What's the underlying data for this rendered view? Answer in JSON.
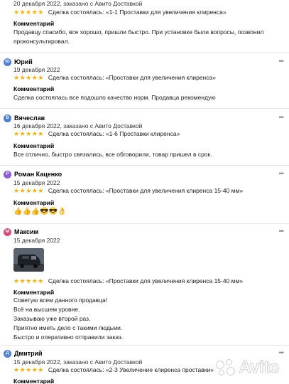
{
  "colors": {
    "star": "#ffb000",
    "avatar_yu": "#4a7fd4",
    "avatar_v": "#4a7fd4",
    "avatar_r": "#8a5bd6",
    "avatar_m": "#d94a7a",
    "avatar_d": "#4a7fd4"
  },
  "reviews": [
    {
      "meta": "20 декабря 2022, заказано с Авито Доставкой",
      "stars": "★★★★★",
      "deal": "Сделка состоялась: «1-1 Проставки для увеличения клиренса»",
      "comment_label": "Комментарий",
      "comment_lines": [
        "Продавцу спасибо, все хорошо, пришли быстро. При установке были вопросы, позвонил",
        "проконсультировал."
      ]
    },
    {
      "avatar": "Ю",
      "name": "Юрий",
      "more": "•••",
      "meta": "19 декабря 2022",
      "stars": "★★★★★",
      "deal": "Сделка состоялась: «Проставки для увеличения клиренса»",
      "comment_label": "Комментарий",
      "comment_lines": [
        "Сделка состоялась все подошло качество норм. Продавца рекомендую"
      ]
    },
    {
      "avatar": "В",
      "name": "Вячеслав",
      "more": "•••",
      "meta": "16 декабря 2022, заказано с Авито Доставкой",
      "stars": "★★★★★",
      "deal": "Сделка состоялась: «1-6 Проставки клиренса»",
      "comment_label": "Комментарий",
      "comment_lines": [
        "Все отлично, быстро связались, все обговорили, товар пришел в срок."
      ]
    },
    {
      "avatar": "Р",
      "name": "Роман Каценко",
      "more": "•••",
      "meta": "15 декабря 2022",
      "stars": "★★★★★",
      "deal": "Сделка состоялась: «Проставки для увеличения клиренса 15-40 мм»",
      "comment_label": "Комментарий",
      "comment_lines": [
        "👍👍👍😎😎👌"
      ]
    },
    {
      "avatar": "М",
      "name": "Максим",
      "more": "•••",
      "meta": "15 декабря 2022",
      "stars": "★★★★★",
      "deal": "Сделка состоялась: «Проставки для увеличения клиренса 15-40 мм»",
      "comment_label": "Комментарий",
      "comment_lines": [
        "Советую всем данного продавца!",
        "Всё на высшем уровне.",
        "Заказываю уже второй раз.",
        "Приятно иметь дело с такими людьми.",
        "Быстро и оперативно отправили заказ."
      ]
    },
    {
      "avatar": "Д",
      "name": "Дмитрий",
      "more": "•••",
      "meta": "15 декабря 2022, заказано с Авито Доставкой",
      "stars": "★★★★★",
      "deal": "Сделка состоялась: «2-3 Увеличение клиренса проставки»",
      "comment_label": "Комментарий"
    }
  ],
  "watermark": {
    "text": "Avito"
  }
}
